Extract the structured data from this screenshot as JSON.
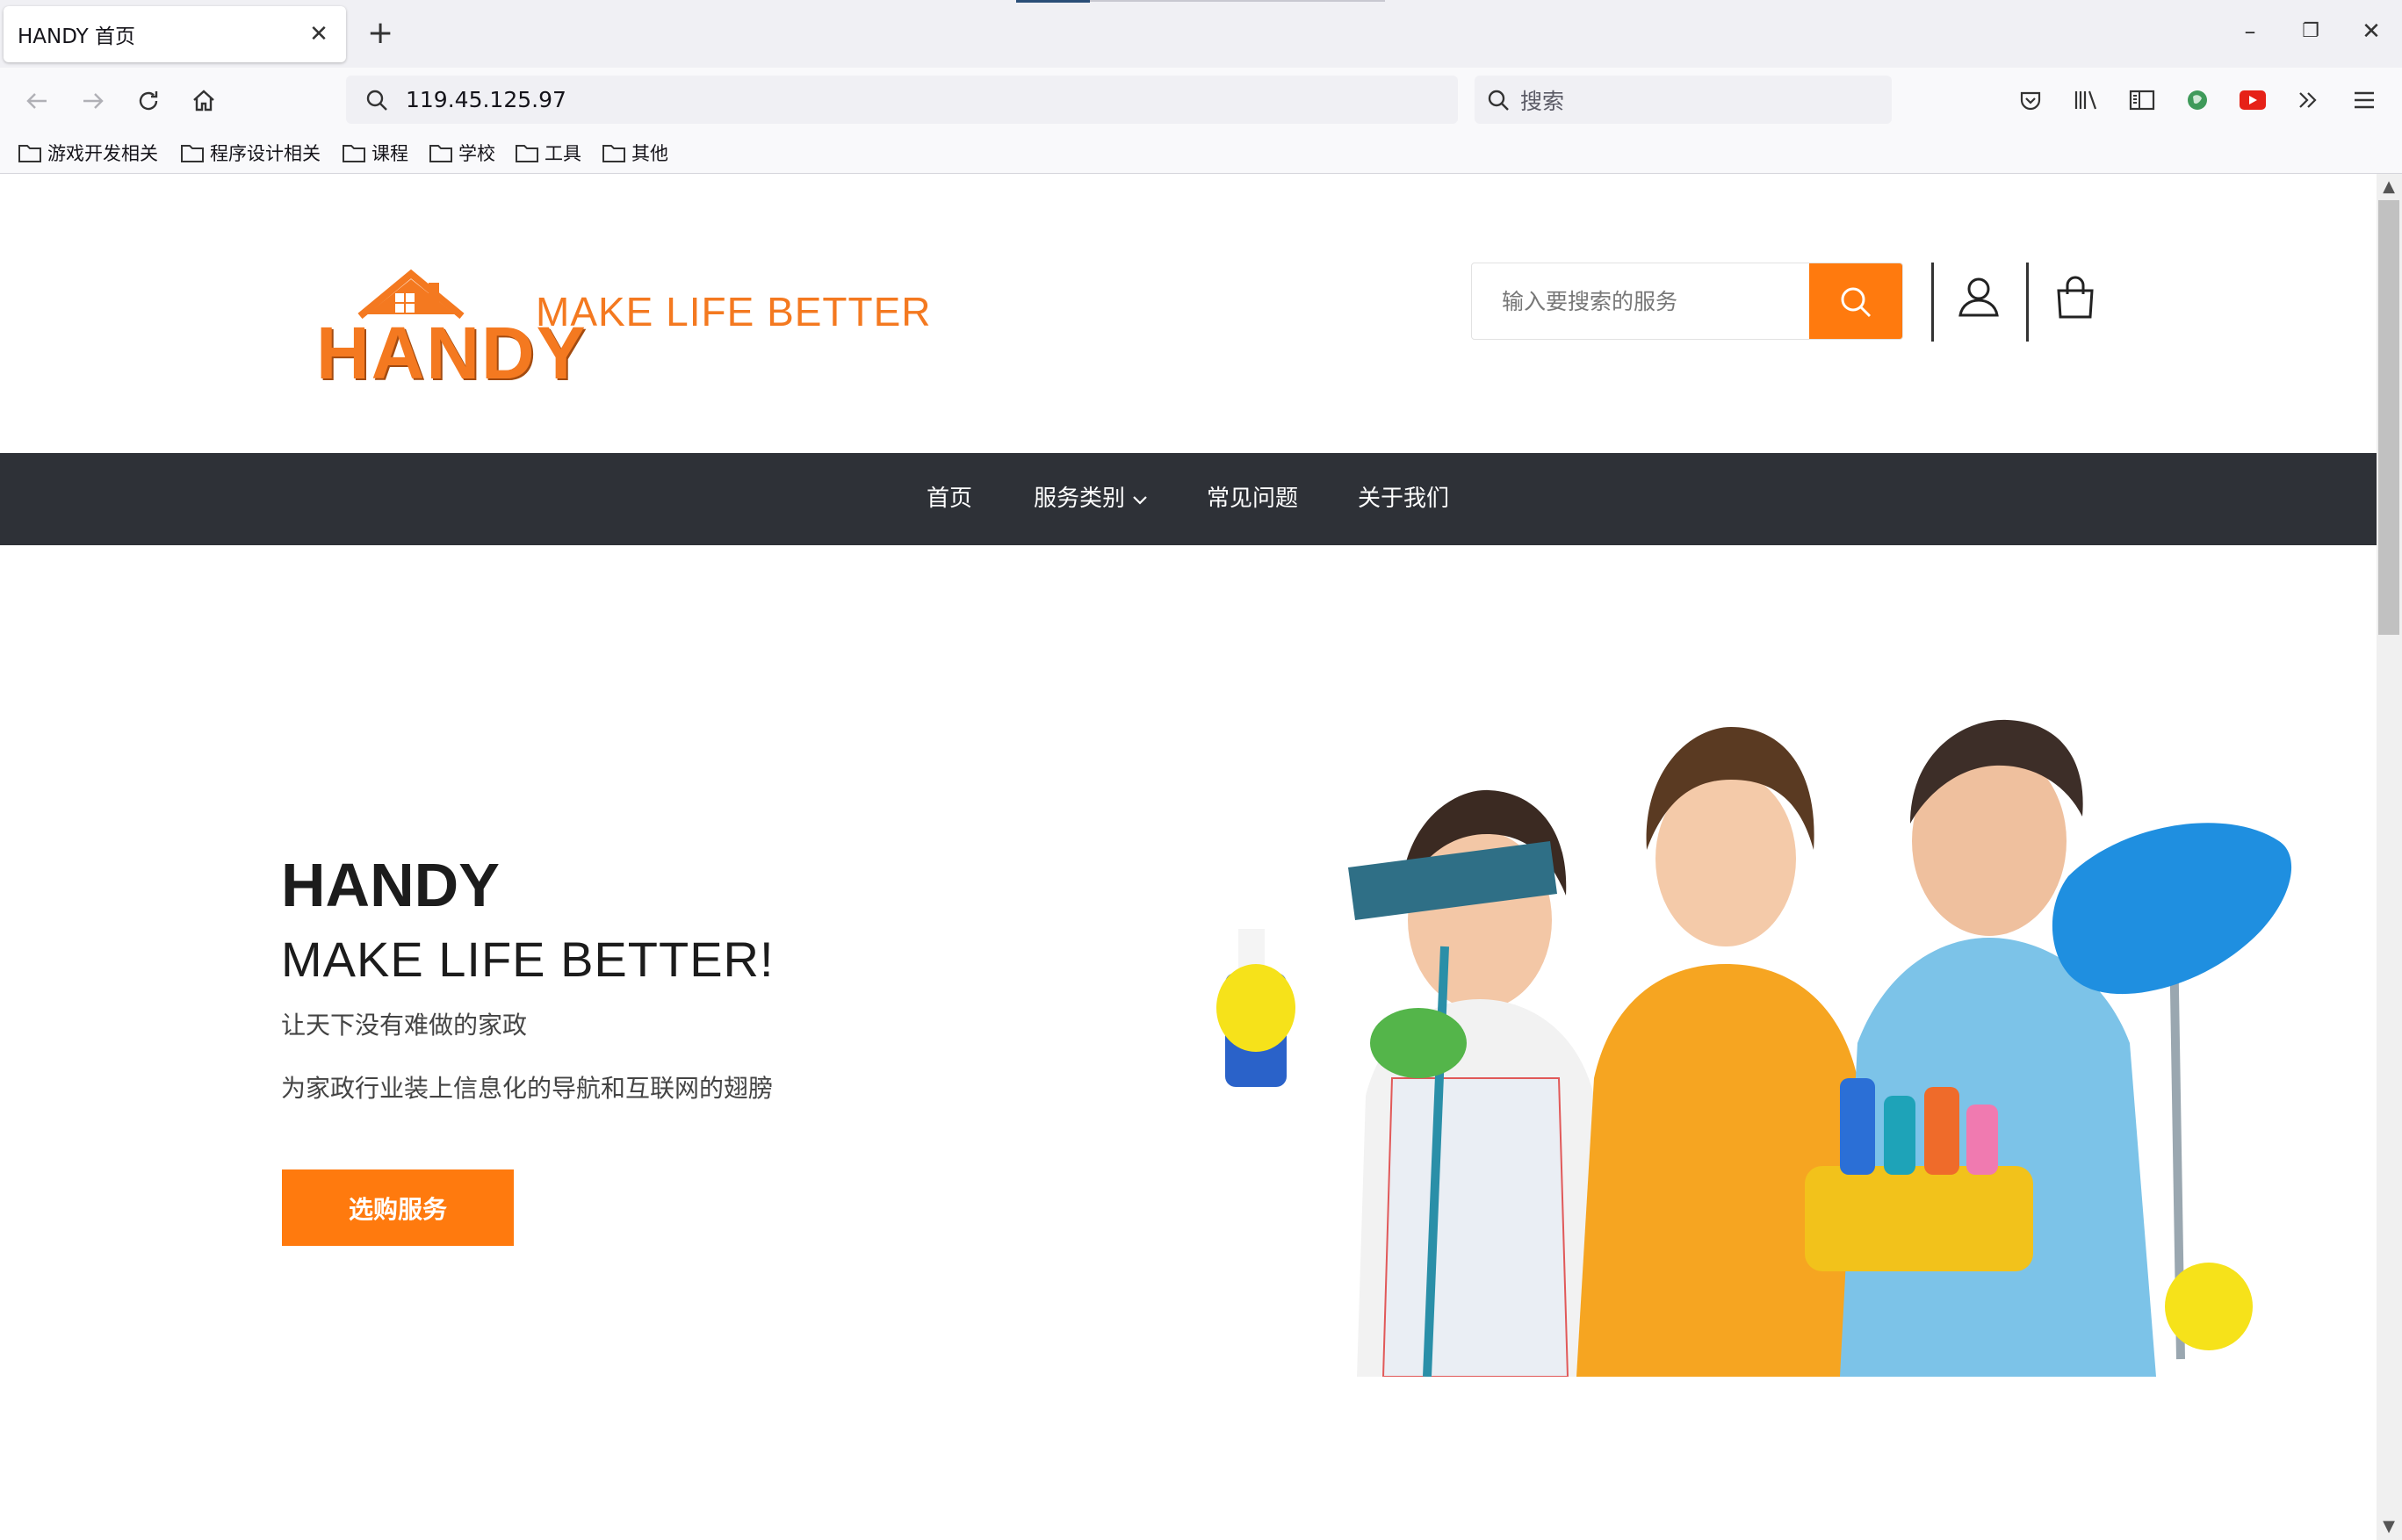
{
  "browser": {
    "tab_title": "HANDY 首页",
    "url": "119.45.125.97",
    "search_placeholder": "搜索",
    "bookmarks": [
      "游戏开发相关",
      "程序设计相关",
      "课程",
      "学校",
      "工具",
      "其他"
    ]
  },
  "site": {
    "logo_word": "HANDY",
    "logo_tagline": "MAKE LIFE BETTER",
    "search_placeholder": "输入要搜索的服务",
    "nav": {
      "home": "首页",
      "categories": "服务类别",
      "faq": "常见问题",
      "about": "关于我们"
    },
    "hero": {
      "title": "HANDY",
      "subtitle": "MAKE LIFE BETTER!",
      "line1": "让天下没有难做的家政",
      "line2": "为家政行业装上信息化的导航和互联网的翅膀",
      "cta": "选购服务"
    }
  },
  "colors": {
    "accent": "#ff7a0e",
    "nav_bg": "#2e3137",
    "logo_orange": "#f47920"
  }
}
